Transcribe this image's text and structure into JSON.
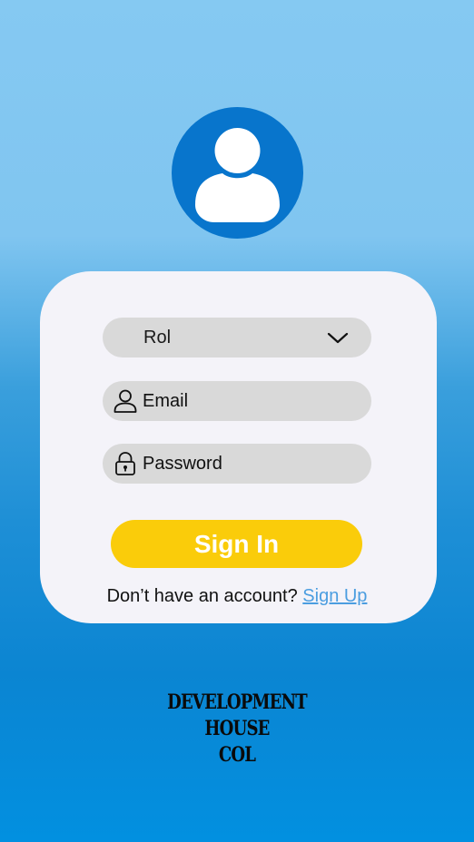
{
  "avatar": {
    "icon": "user-avatar-icon",
    "bg_color": "#0875cc"
  },
  "form": {
    "role": {
      "label": "Rol",
      "icon": "chevron-down-icon"
    },
    "email": {
      "placeholder": "Email",
      "icon": "user-icon"
    },
    "password": {
      "placeholder": "Password",
      "icon": "lock-icon"
    },
    "signin_label": "Sign In",
    "signup_prompt": "Don’t have an account?",
    "signup_link": "Sign Up"
  },
  "brand": {
    "line1": "DEVELOPMENT",
    "line2": "HOUSE",
    "line3": "COL"
  },
  "colors": {
    "primary": "#0875cc",
    "accent": "#facc0a",
    "link": "#4b9de0",
    "card": "#f4f3f9",
    "field": "#d9d9d9"
  }
}
